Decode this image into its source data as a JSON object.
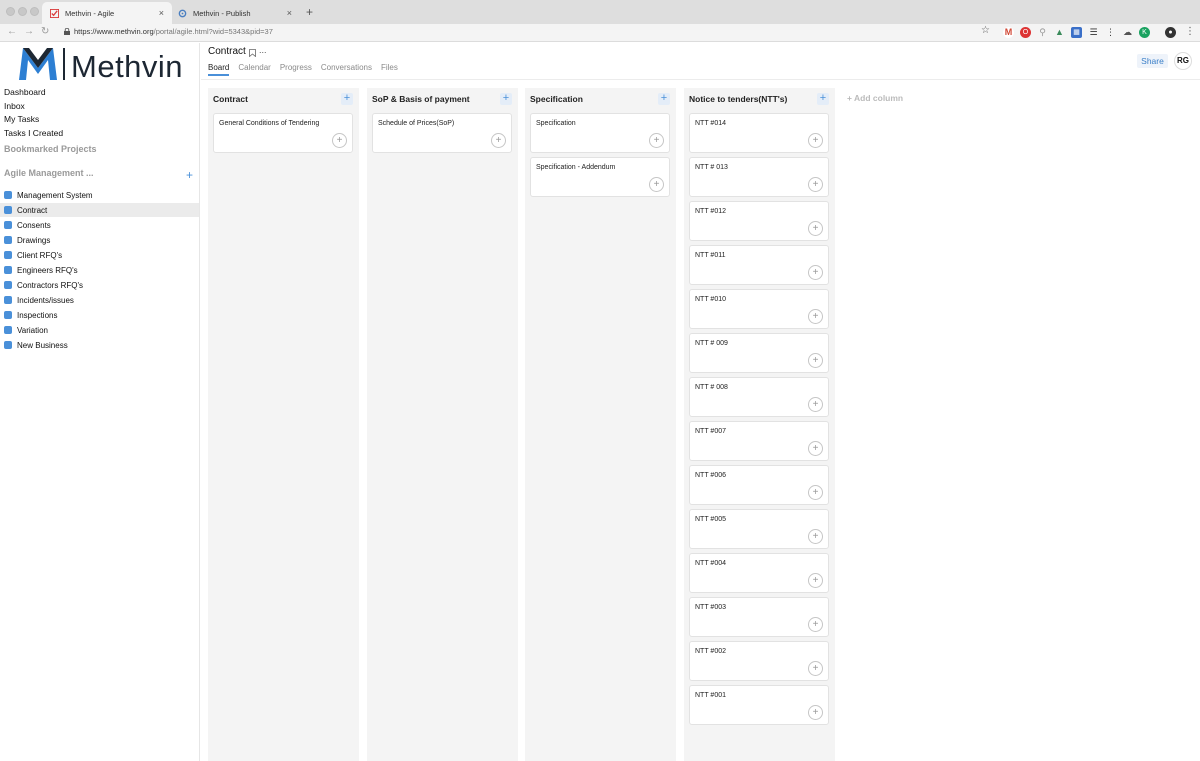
{
  "browser": {
    "tabs": [
      {
        "title": "Methvin - Agile",
        "active": true
      },
      {
        "title": "Methvin - Publish",
        "active": false
      }
    ],
    "new_tab": "+",
    "url_host": "https://www.methvin.org",
    "url_path": "/portal/agile.html?wid=5343&pid=37",
    "tab_close": "×"
  },
  "sidebar": {
    "logo_text": "Methvin",
    "nav": [
      "Dashboard",
      "Inbox",
      "My Tasks",
      "Tasks I Created"
    ],
    "bookmarked_label": "Bookmarked Projects",
    "group_label": "Agile Management ...",
    "add_symbol": "+",
    "projects": [
      "Management System",
      "Contract",
      "Consents",
      "Drawings",
      "Client RFQ's",
      "Engineers RFQ's",
      "Contractors RFQ's",
      "Incidents/issues",
      "Inspections",
      "Variation",
      "New Business"
    ],
    "selected_project": "Contract",
    "swatch_color": "#4a90d9"
  },
  "header": {
    "title": "Contract",
    "more": "...",
    "views": [
      "Board",
      "Calendar",
      "Progress",
      "Conversations",
      "Files"
    ],
    "active_view": "Board",
    "share_label": "Share",
    "avatar_initials": "RG"
  },
  "board": {
    "add_column_label": "+ Add column",
    "columns": [
      {
        "title": "Contract",
        "cards": [
          "General Conditions of Tendering"
        ]
      },
      {
        "title": "SoP & Basis of payment",
        "cards": [
          "Schedule of Prices(SoP)"
        ]
      },
      {
        "title": "Specification",
        "cards": [
          "Specification",
          "Specification - Addendum"
        ]
      },
      {
        "title": "Notice to tenders(NTT's)",
        "cards": [
          "NTT #014",
          "NTT # 013",
          "NTT #012",
          "NTT #011",
          "NTT #010",
          "NTT # 009",
          "NTT # 008",
          "NTT #007",
          "NTT #006",
          "NTT #005",
          "NTT #004",
          "NTT #003",
          "NTT #002",
          "NTT #001"
        ]
      }
    ]
  },
  "colors": {
    "accent": "#4a90d9",
    "column_bg": "#f4f4f4"
  }
}
